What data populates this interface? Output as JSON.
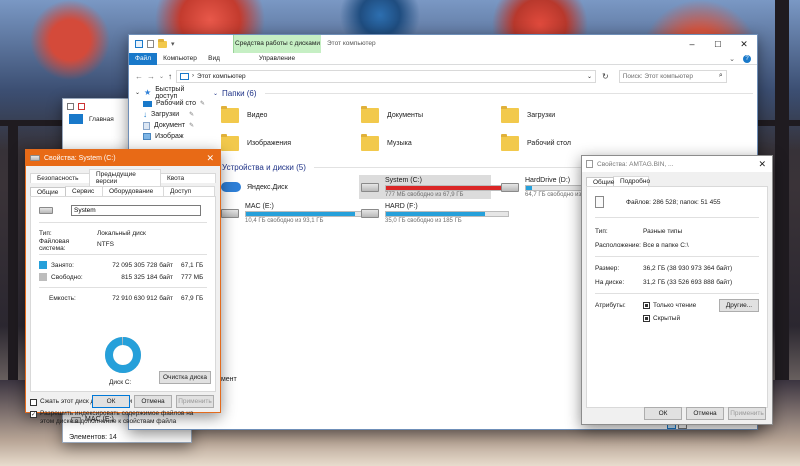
{
  "explorer": {
    "qat_icons": [
      "save-icon",
      "properties-icon",
      "folder-icon"
    ],
    "context_tab": "Средства работы с дисками",
    "title": "Этот компьютер",
    "ribbon_tabs": [
      "Файл",
      "Компьютер",
      "Вид",
      "Управление"
    ],
    "address": "Этот компьютер",
    "search_placeholder": "Поиск: Этот компьютер",
    "nav_items": [
      {
        "label": "Быстрый доступ",
        "icon": "star-icon"
      },
      {
        "label": "Рабочий сто",
        "icon": "desktop-icon"
      },
      {
        "label": "Загрузки",
        "icon": "download-icon"
      },
      {
        "label": "Документ",
        "icon": "document-icon"
      },
      {
        "label": "Изображ",
        "icon": "image-icon"
      }
    ],
    "folders_header": "Папки (6)",
    "folders": [
      {
        "name": "Видео",
        "icon": "video-folder-icon"
      },
      {
        "name": "Документы",
        "icon": "documents-folder-icon"
      },
      {
        "name": "Загрузки",
        "icon": "downloads-folder-icon"
      },
      {
        "name": "Изображения",
        "icon": "pictures-folder-icon"
      },
      {
        "name": "Музыка",
        "icon": "music-folder-icon"
      },
      {
        "name": "Рабочий стол",
        "icon": "desktop-folder-icon"
      }
    ],
    "devices_header": "Устройства и диски (5)",
    "drives": [
      {
        "name": "Яндекс.Диск",
        "free": "",
        "fill": 0,
        "color": "#26a0da",
        "cloud": true
      },
      {
        "name": "System (C:)",
        "free": "777 МБ свободно из 67,9 ГБ",
        "fill": 0.99,
        "color": "#da2626"
      },
      {
        "name": "HardDrive (D:)",
        "free": "64,7 ГБ свободно из 67,9 ГБ",
        "fill": 0.05,
        "color": "#26a0da"
      },
      {
        "name": "MAC (E:)",
        "free": "10,4 ГБ свободно из 93,1 ГБ",
        "fill": 0.89,
        "color": "#26a0da"
      },
      {
        "name": "HARD (F:)",
        "free": "35,0 ГБ свободно из 185 ГБ",
        "fill": 0.81,
        "color": "#26a0da"
      }
    ],
    "status_partial": "лемент"
  },
  "back_explorer": {
    "ribbon_tab": "Главная",
    "nav_bottom": "MAC (E:)",
    "status": "Элементов: 14"
  },
  "drive_props": {
    "title": "Свойства: System (C:)",
    "tabs_row1": [
      "Безопасность",
      "Предыдущие версии",
      "Квота"
    ],
    "tabs_row2": [
      "Общие",
      "Сервис",
      "Оборудование",
      "Доступ"
    ],
    "name_value": "System",
    "type_label": "Тип:",
    "type_value": "Локальный диск",
    "fs_label": "Файловая система:",
    "fs_value": "NTFS",
    "used_label": "Занято:",
    "used_bytes": "72 095 305 728 байт",
    "used_size": "67,1 ГБ",
    "free_label": "Свободно:",
    "free_bytes": "815 325 184 байт",
    "free_size": "777 МБ",
    "cap_label": "Емкость:",
    "cap_bytes": "72 910 630 912 байт",
    "cap_size": "67,9 ГБ",
    "used_fraction": 0.989,
    "used_color": "#26a0da",
    "free_color": "#bdbdbd",
    "disk_label": "Диск C:",
    "cleanup": "Очистка диска",
    "compress": "Сжать этот диск для экономии места",
    "index": "Разрешить индексировать содержимое файлов на этом диске в дополнение к свойствам файла",
    "ok": "ОК",
    "cancel": "Отмена",
    "apply": "Применить"
  },
  "file_props": {
    "title": "Свойства: AMTAG.BIN, ...",
    "tabs": [
      "Общие",
      "Подробно"
    ],
    "summary": "Файлов: 286 528; папок: 51 455",
    "type_label": "Тип:",
    "type_value": "Разные типы",
    "loc_label": "Расположение:",
    "loc_value": "Все в папке C:\\",
    "size_label": "Размер:",
    "size_value": "36,2 ГБ (38 930 973 364 байт)",
    "disk_label": "На диске:",
    "disk_value": "31,2 ГБ (33 526 693 888 байт)",
    "attr_label": "Атрибуты:",
    "readonly": "Только чтение",
    "hidden": "Скрытый",
    "other": "Другие...",
    "ok": "ОК",
    "cancel": "Отмена",
    "apply": "Применить"
  }
}
